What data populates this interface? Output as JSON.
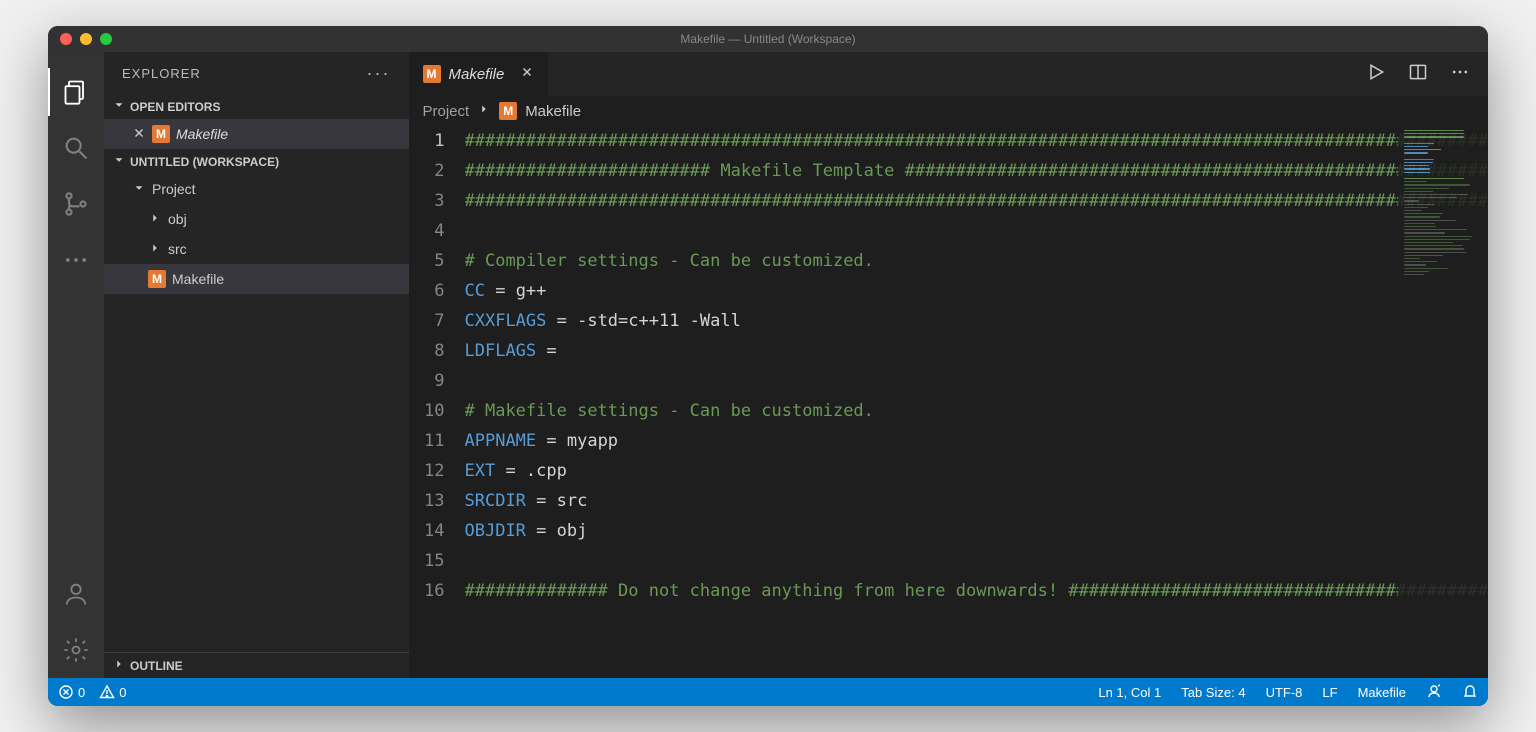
{
  "window_title": "Makefile — Untitled (Workspace)",
  "sidebar": {
    "title": "EXPLORER",
    "sections": {
      "open_editors_label": "OPEN EDITORS",
      "workspace_label": "UNTITLED (WORKSPACE)",
      "outline_label": "OUTLINE"
    },
    "open_editor_file": "Makefile",
    "tree": {
      "project": "Project",
      "obj": "obj",
      "src": "src",
      "makefile": "Makefile"
    }
  },
  "tabs": {
    "active": "Makefile"
  },
  "breadcrumb": {
    "project": "Project",
    "file": "Makefile"
  },
  "code_lines": [
    {
      "type": "comment",
      "text": "####################################################################################################"
    },
    {
      "type": "comment",
      "text": "######################## Makefile Template #########################################################"
    },
    {
      "type": "comment",
      "text": "####################################################################################################"
    },
    {
      "type": "blank",
      "text": ""
    },
    {
      "type": "comment",
      "text": "# Compiler settings - Can be customized."
    },
    {
      "type": "assign",
      "var": "CC",
      "rest": " = g++"
    },
    {
      "type": "assign",
      "var": "CXXFLAGS",
      "rest": " = -std=c++11 -Wall"
    },
    {
      "type": "assign",
      "var": "LDFLAGS",
      "rest": " ="
    },
    {
      "type": "blank",
      "text": ""
    },
    {
      "type": "comment",
      "text": "# Makefile settings - Can be customized."
    },
    {
      "type": "assign",
      "var": "APPNAME",
      "rest": " = myapp"
    },
    {
      "type": "assign",
      "var": "EXT",
      "rest": " = .cpp"
    },
    {
      "type": "assign",
      "var": "SRCDIR",
      "rest": " = src"
    },
    {
      "type": "assign",
      "var": "OBJDIR",
      "rest": " = obj"
    },
    {
      "type": "blank",
      "text": ""
    },
    {
      "type": "comment",
      "text": "############## Do not change anything from here downwards! #########################################"
    }
  ],
  "statusbar": {
    "errors": "0",
    "warnings": "0",
    "position": "Ln 1, Col 1",
    "tabsize": "Tab Size: 4",
    "encoding": "UTF-8",
    "eol": "LF",
    "language": "Makefile"
  }
}
